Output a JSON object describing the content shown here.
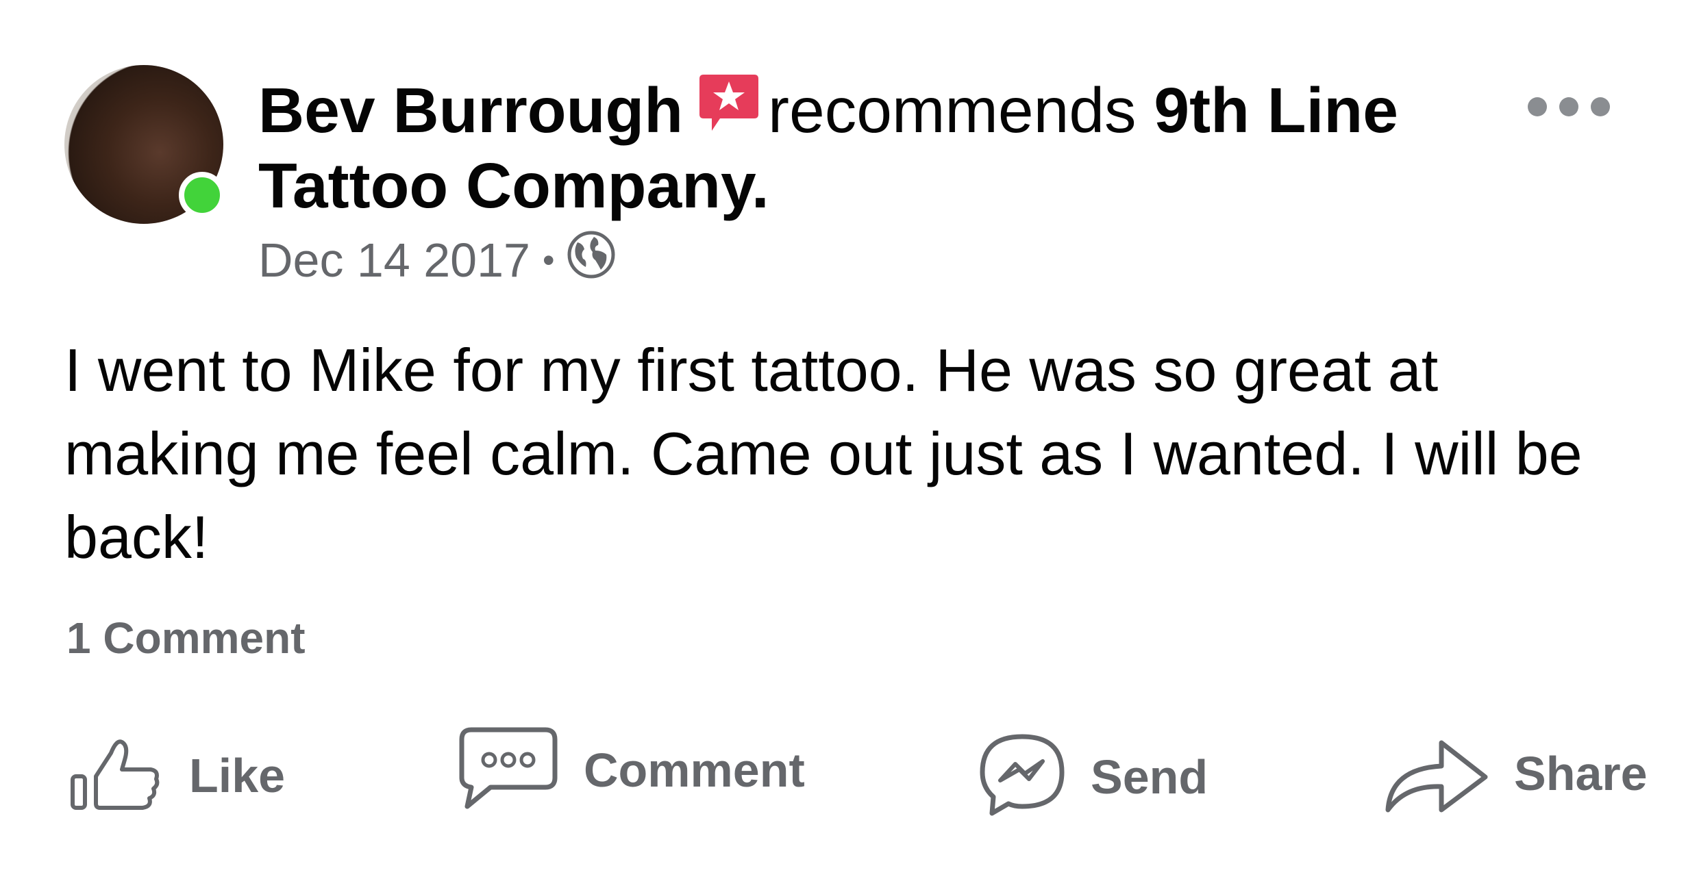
{
  "post": {
    "author": "Bev Burrough",
    "action_text": "recommends",
    "page_name": "9th Line Tattoo Company.",
    "date": "Dec 14 2017",
    "separator": "•",
    "privacy_icon": "globe-icon",
    "body": "I went to Mike for my first tattoo. He was so great at making me feel calm. Came out just as I wanted. I will be back!",
    "comment_count": "1 Comment"
  },
  "icons": {
    "recommend": "recommend-star-icon",
    "more": "more-options-icon"
  },
  "actions": {
    "like": "Like",
    "comment": "Comment",
    "send": "Send",
    "share": "Share"
  },
  "colors": {
    "recommend_badge": "#e63c5a",
    "online": "#42d33a",
    "secondary_text": "#65676b",
    "icon_gray": "#65676b"
  }
}
